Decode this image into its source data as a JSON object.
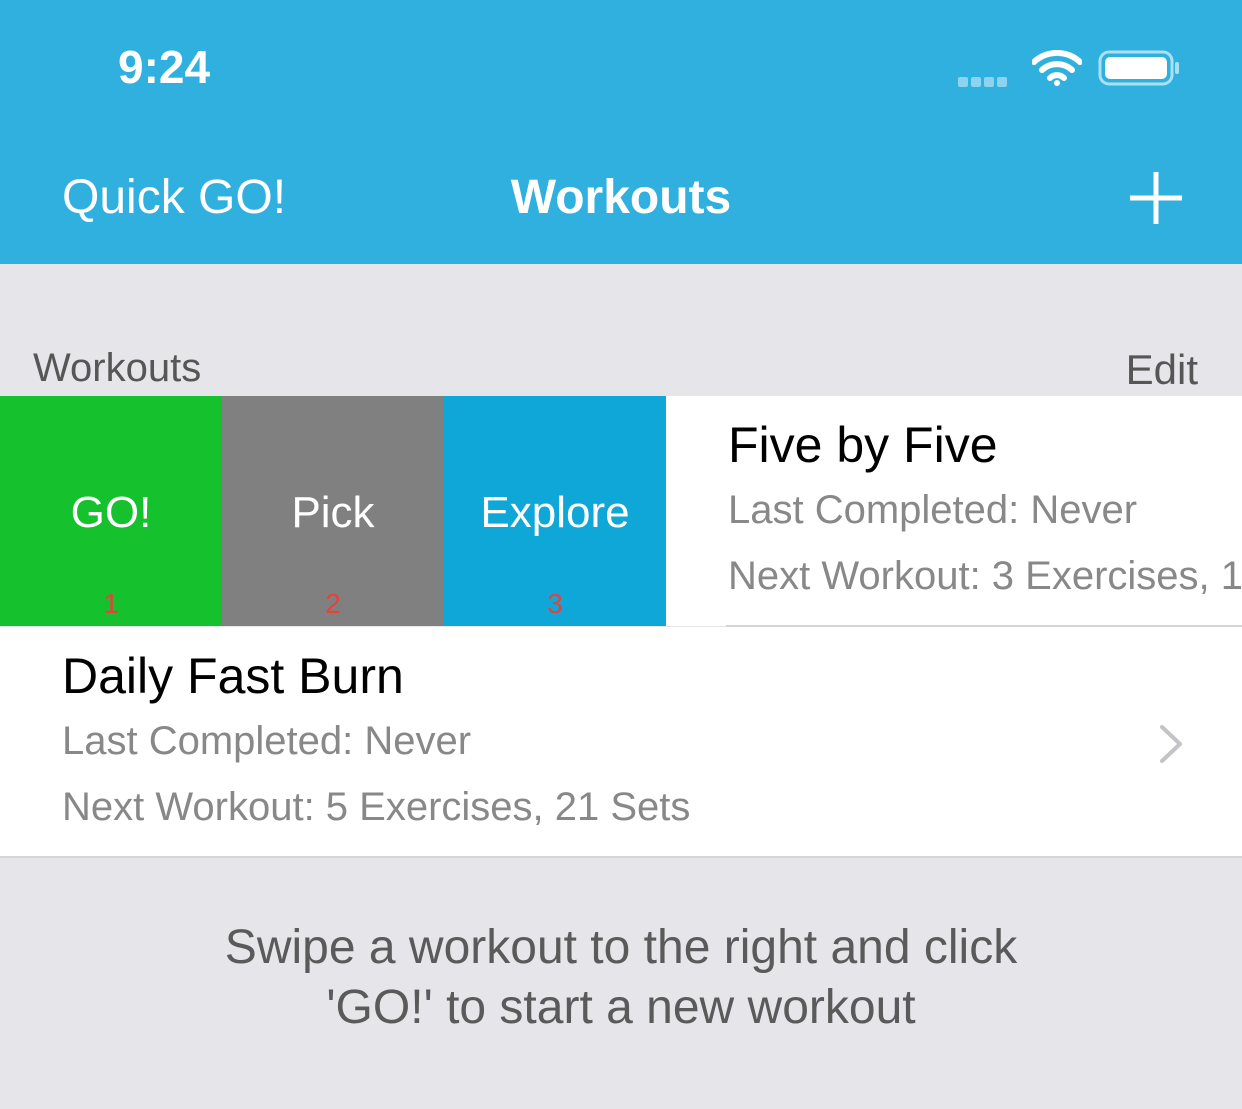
{
  "status_bar": {
    "time": "9:24"
  },
  "nav": {
    "left_label": "Quick GO!",
    "title": "Workouts",
    "right_icon": "plus-icon"
  },
  "section": {
    "header": "Workouts",
    "edit_label": "Edit"
  },
  "swipe_actions": [
    {
      "label": "GO!",
      "number": "1",
      "color": "#15c12c"
    },
    {
      "label": "Pick",
      "number": "2",
      "color": "#808080"
    },
    {
      "label": "Explore",
      "number": "3",
      "color": "#0ea7d8"
    }
  ],
  "workouts": [
    {
      "title": "Five by Five",
      "last_completed": "Last Completed: Never",
      "next_workout": "Next Workout: 3 Exercises, 1"
    },
    {
      "title": "Daily Fast Burn",
      "last_completed": "Last Completed: Never",
      "next_workout": "Next Workout: 5 Exercises, 21 Sets"
    }
  ],
  "footer": {
    "line1": "Swipe a workout to the right and click",
    "line2": "'GO!' to start a new workout"
  },
  "colors": {
    "nav_background": "#2fb0de",
    "page_background": "#e6e5ea",
    "go": "#15c12c",
    "pick": "#808080",
    "explore": "#0ea7d8"
  }
}
